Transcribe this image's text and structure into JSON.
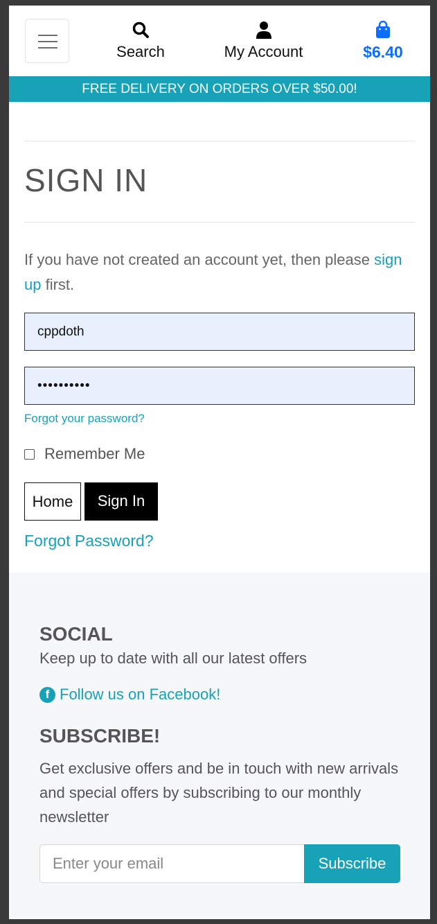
{
  "header": {
    "search_label": "Search",
    "account_label": "My Account",
    "bag_total": "$6.40"
  },
  "banner": {
    "text": "FREE DELIVERY ON ORDERS OVER $50.00!"
  },
  "signin": {
    "title": "SIGN IN",
    "intro_before": "If you have not created an account yet, then please ",
    "signup_link": "sign up",
    "intro_after": " first.",
    "username_value": "cppdoth",
    "password_masked": "••••••••••",
    "forgot_small": "Forgot your password?",
    "remember_label": "Remember Me",
    "home_button": "Home",
    "signin_button": "Sign In",
    "forgot_big": "Forgot Password?"
  },
  "footer": {
    "social_heading": "SOCIAL",
    "social_text": "Keep up to date with all our latest offers",
    "facebook_link": "Follow us on Facebook!",
    "subscribe_heading": "SUBSCRIBE!",
    "subscribe_text": "Get exclusive offers and be in touch with new arrivals and special offers by subscribing to our monthly newsletter",
    "email_placeholder": "Enter your email",
    "subscribe_button": "Subscribe"
  },
  "colors": {
    "accent": "#17a2b8",
    "bag": "#0d6efd",
    "field_bg": "#e8f0fe"
  },
  "icons": [
    "menu-icon",
    "search-icon",
    "user-icon",
    "shopping-bag-icon",
    "facebook-icon"
  ]
}
